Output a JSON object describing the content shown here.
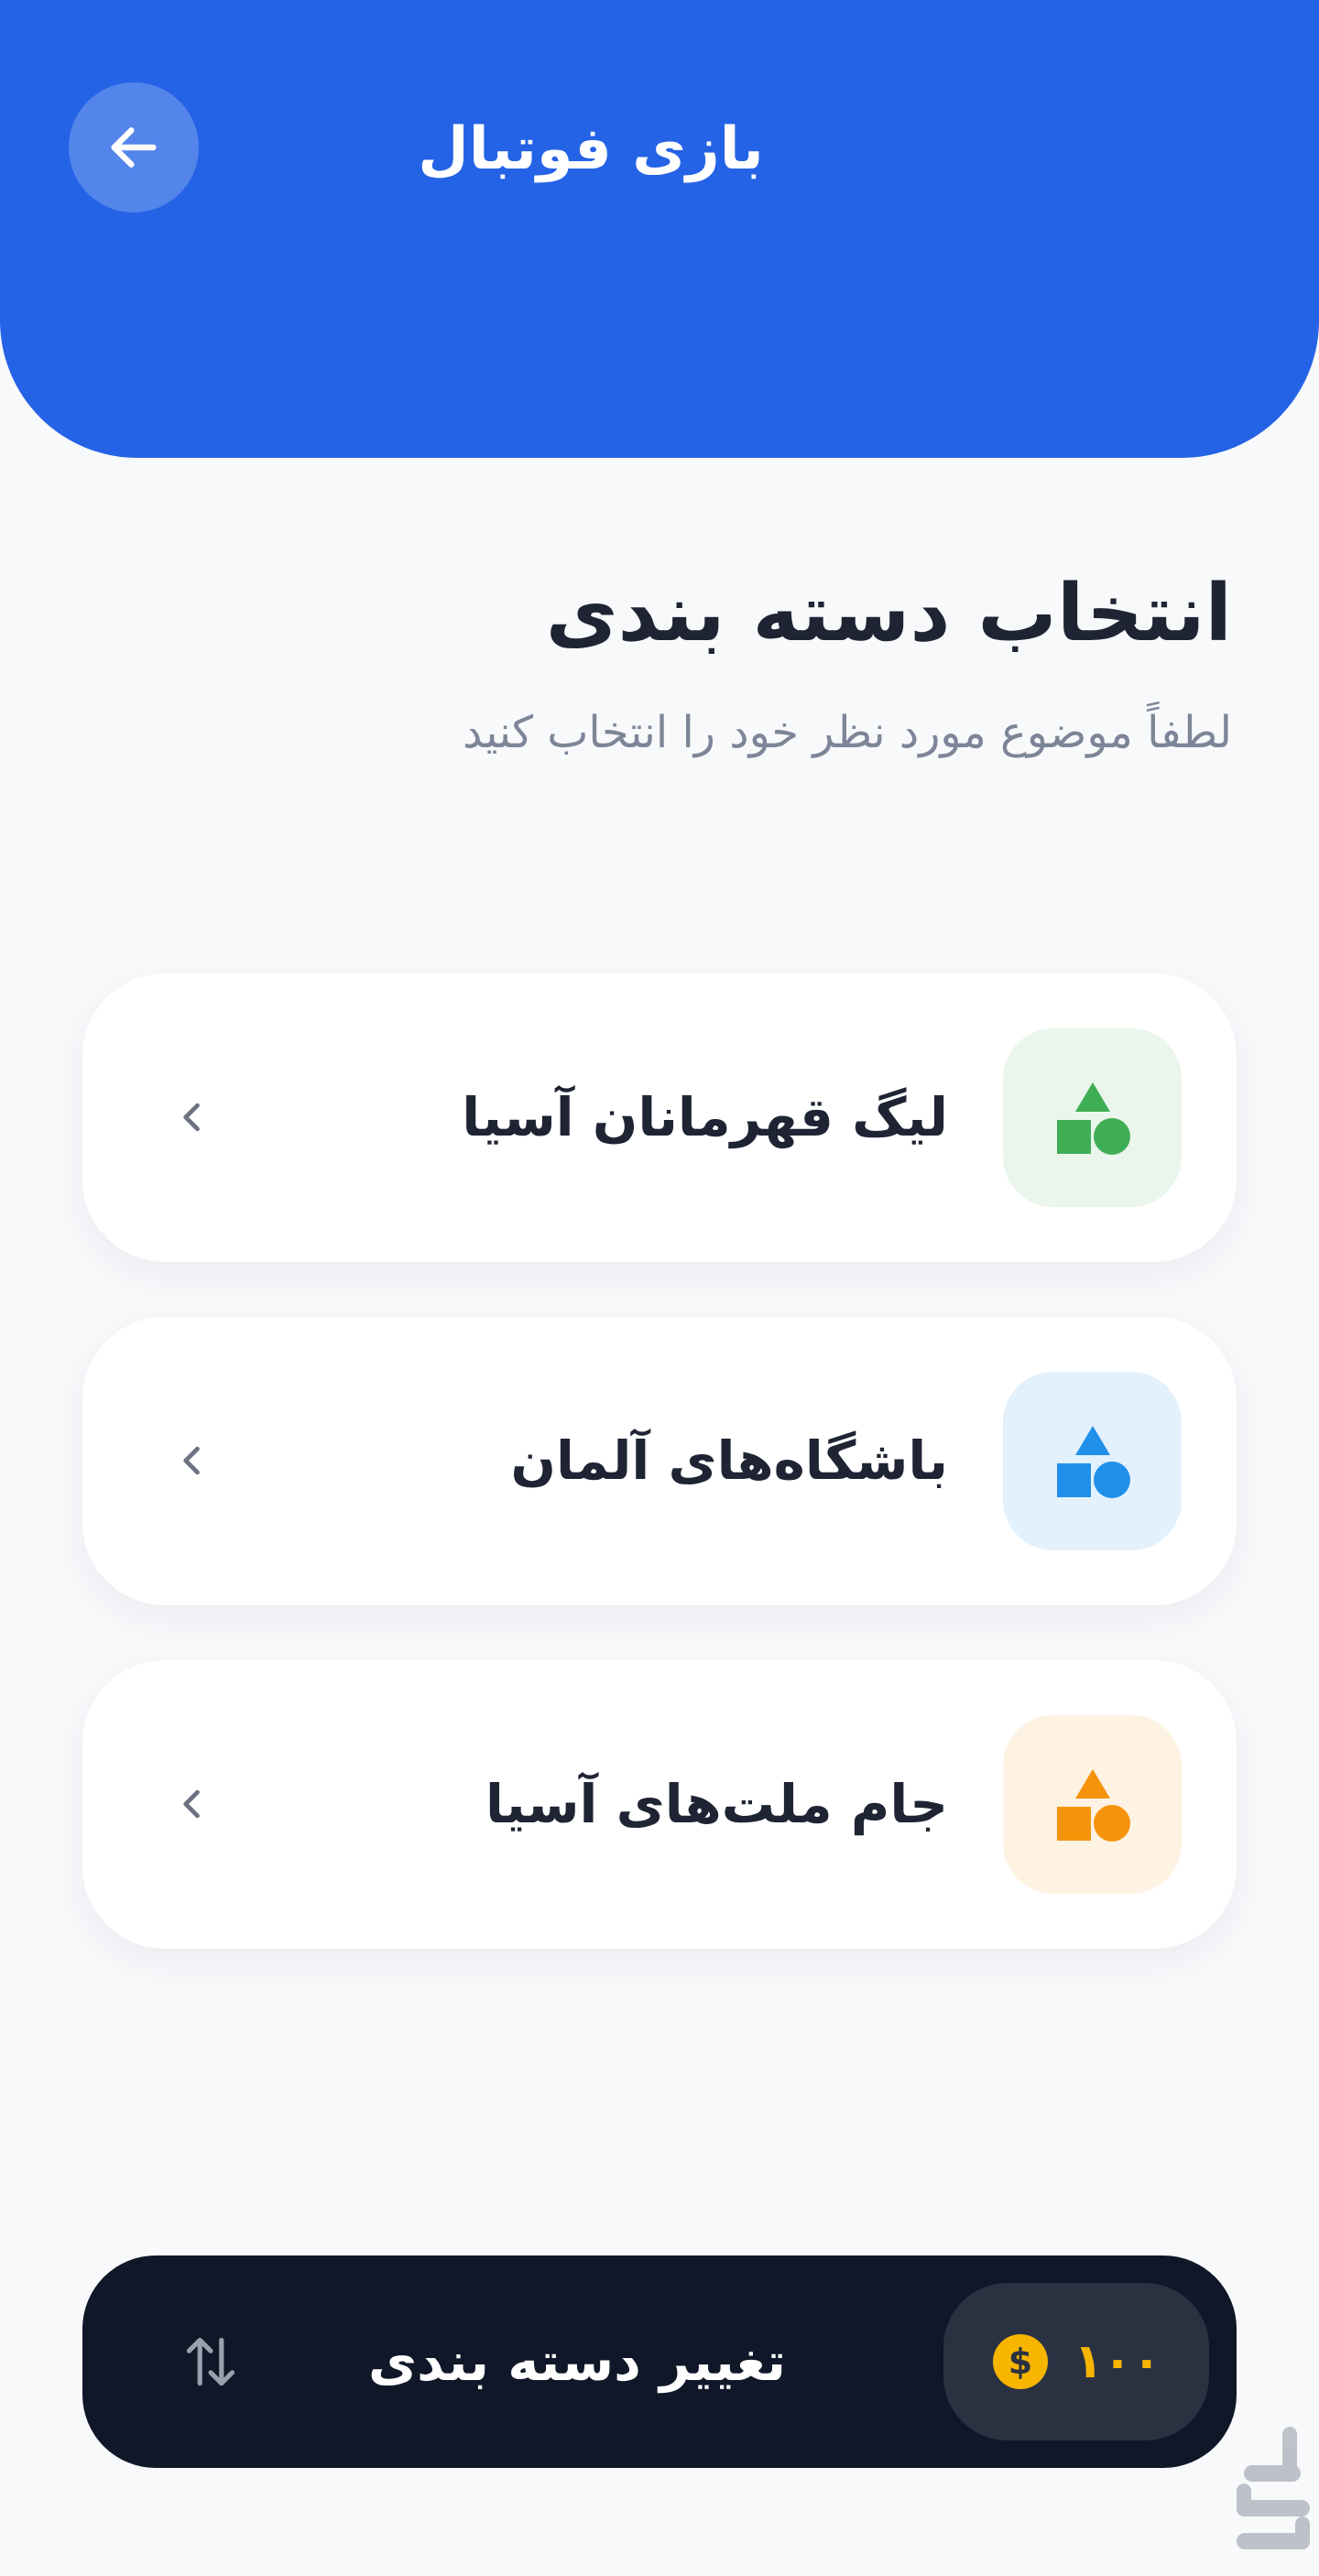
{
  "header": {
    "title": "بازی فوتبال",
    "back_icon": "arrow-left-icon",
    "color": "#2563e6"
  },
  "intro": {
    "title": "انتخاب دسته بندی",
    "subtitle": "لطفاً موضوع مورد نظر خود را انتخاب کنید"
  },
  "categories": [
    {
      "label": "لیگ قهرمانان آسیا",
      "icon": "shapes-icon",
      "icon_color": "#3fae55",
      "icon_bg": "#eaf6ec"
    },
    {
      "label": "باشگاه‌های آلمان",
      "icon": "shapes-icon",
      "icon_color": "#2190ea",
      "icon_bg": "#e3f1fd"
    },
    {
      "label": "جام ملت‌های آسیا",
      "icon": "shapes-icon",
      "icon_color": "#f5930b",
      "icon_bg": "#fef2e3"
    }
  ],
  "bottom_bar": {
    "label": "تغییر دسته بندی",
    "coins": "۱۰۰",
    "coin_icon": "dollar-coin-icon",
    "swap_icon": "swap-vertical-icon",
    "coin_color": "#f7b500"
  }
}
